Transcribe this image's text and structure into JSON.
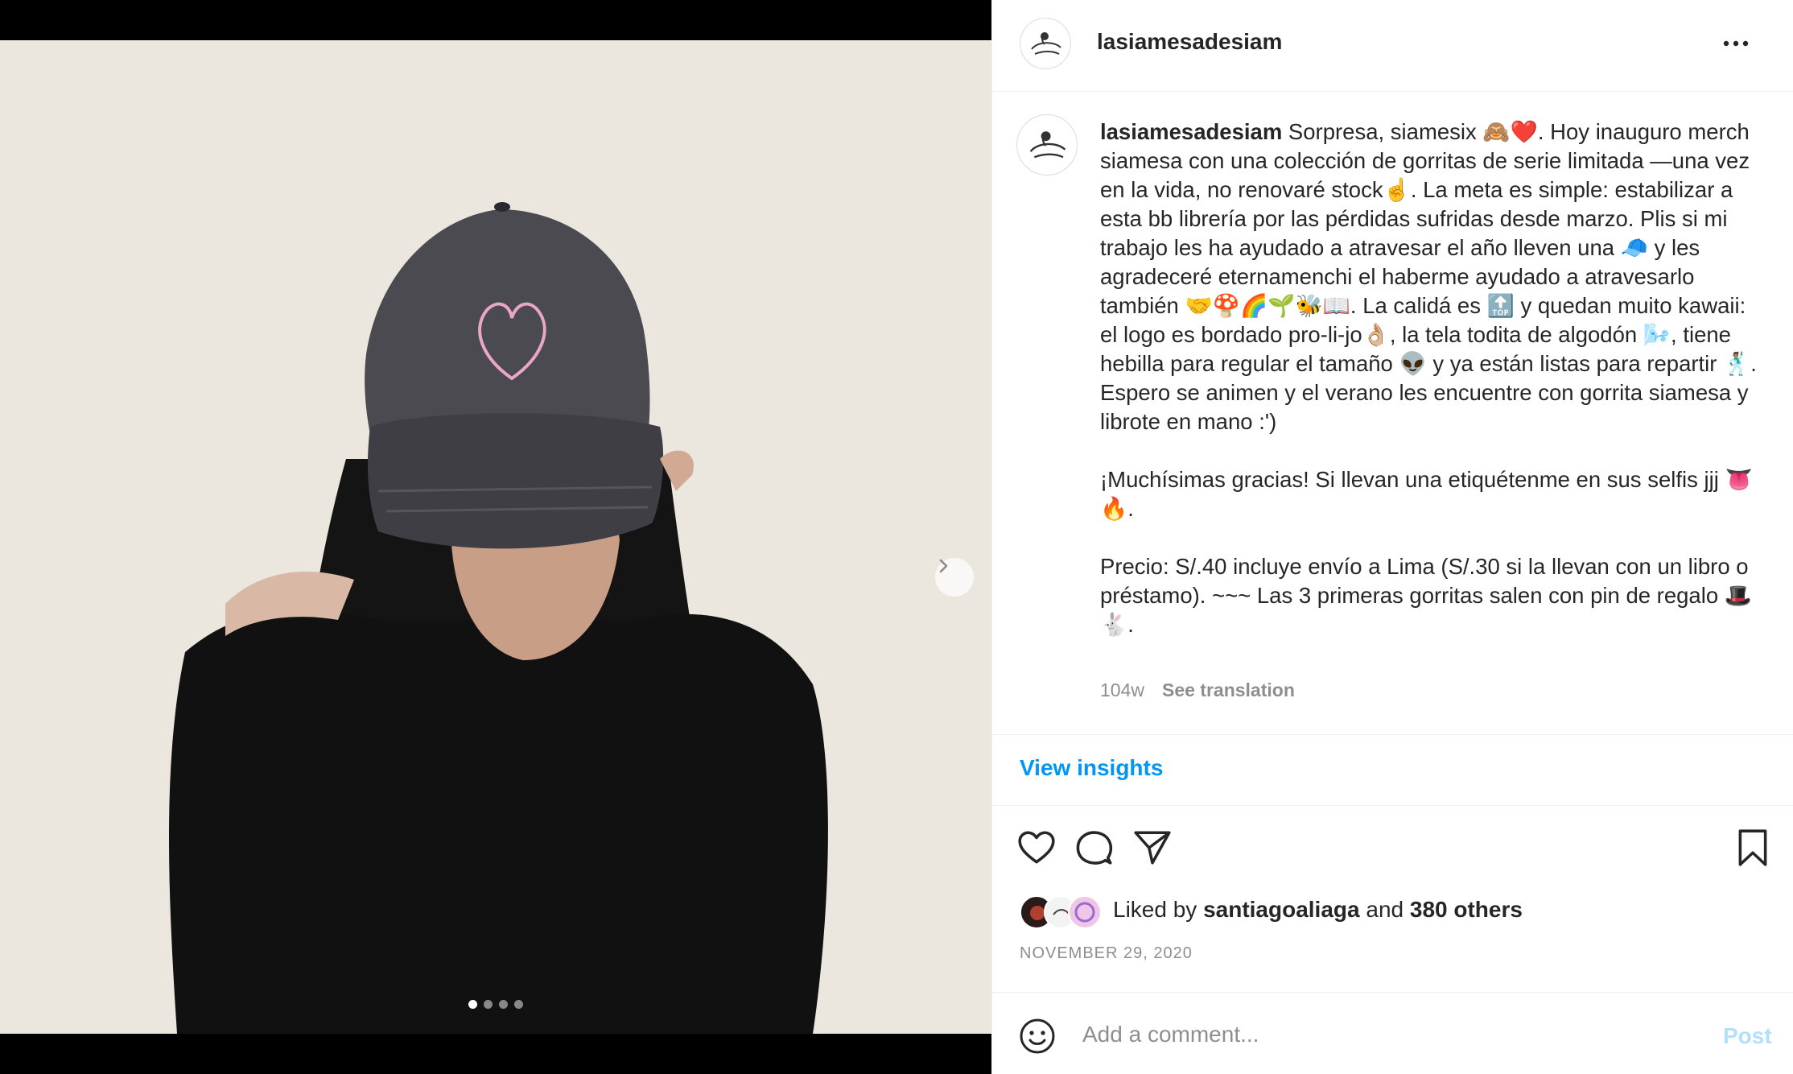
{
  "post": {
    "username": "lasiamesadesiam",
    "caption_user": "lasiamesadesiam",
    "caption_text": " Sorpresa, siamesix 🙈❤️. Hoy inauguro merch siamesa con una colección de gorritas de serie limitada —una vez en la vida, no renovaré stock☝️. La meta es simple: estabilizar a esta bb librería por las pérdidas sufridas desde marzo. Plis si mi trabajo les ha ayudado a atravesar el año lleven una 🧢 y les agradeceré eternamenchi el haberme ayudado a atravesarlo también 🤝🍄🌈🌱🐝📖. La calidá es 🔝 y quedan muito kawaii: el logo es bordado pro-li-jo👌🏼, la tela todita de algodón 🌬️, tiene hebilla para regular el tamaño 👽 y ya están listas para repartir 🕺🏽. Espero se animen y el verano les encuentre con gorrita siamesa y librote en mano :')\n\n¡Muchísimas gracias! Si llevan una etiquétenme en sus selfis jjj 👅🔥.\n\nPrecio: S/.40 incluye envío a Lima (S/.30 si la llevan con un libro o préstamo). ~~~ Las 3 primeras gorritas salen con pin de regalo 🎩🐇.",
    "time_ago": "104w",
    "see_translation": "See translation",
    "view_insights": "View insights",
    "liked_by_prefix": "Liked by ",
    "liked_by_user": "santiagoaliaga",
    "liked_by_mid": " and ",
    "liked_by_others": "380 others",
    "date": "NOVEMBER 29, 2020"
  },
  "media": {
    "carousel_count": 4,
    "active_index": 0
  },
  "comment": {
    "placeholder": "Add a comment...",
    "post_label": "Post"
  },
  "icons": {
    "more": "more-options-icon",
    "like": "heart-icon",
    "comment": "comment-icon",
    "share": "share-icon",
    "save": "bookmark-icon",
    "emoji": "emoji-icon",
    "next": "chevron-right-icon"
  },
  "colors": {
    "link_blue": "#0095f6",
    "post_disabled": "#b2dffc",
    "muted": "#8e8e8e",
    "text": "#262626"
  }
}
